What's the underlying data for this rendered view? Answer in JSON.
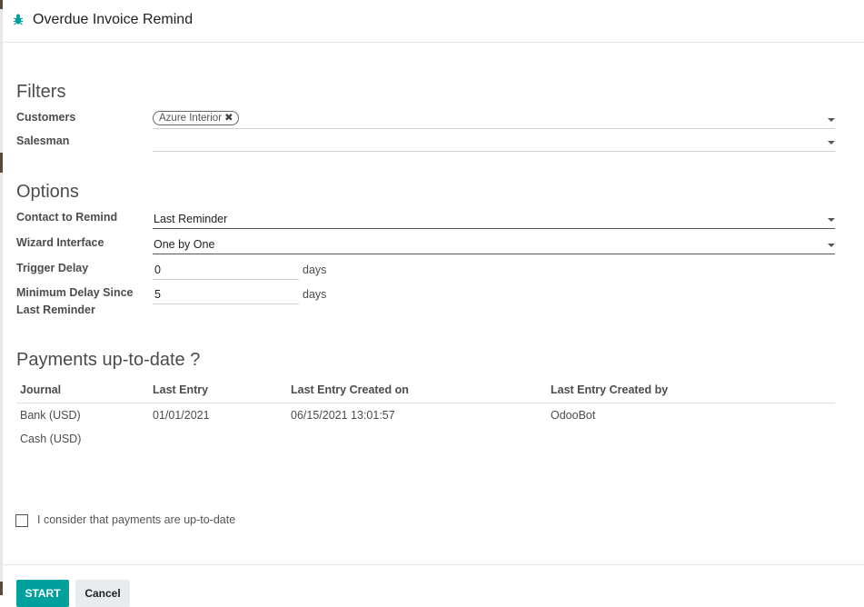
{
  "dialog": {
    "title": "Overdue Invoice Remind",
    "icon": "bug-icon"
  },
  "filters": {
    "section_title": "Filters",
    "customers_label": "Customers",
    "customers_tags": [
      "Azure Interior"
    ],
    "salesman_label": "Salesman",
    "salesman_value": ""
  },
  "options": {
    "section_title": "Options",
    "contact_label": "Contact to Remind",
    "contact_value": "Last Reminder",
    "wizard_label": "Wizard Interface",
    "wizard_value": "One by One",
    "trigger_label": "Trigger Delay",
    "trigger_value": "0",
    "trigger_unit": "days",
    "min_delay_label_line1": "Minimum Delay Since",
    "min_delay_label_line2": "Last Reminder",
    "min_delay_value": "5",
    "min_delay_unit": "days"
  },
  "payments": {
    "section_title": "Payments up-to-date ?",
    "columns": [
      "Journal",
      "Last Entry",
      "Last Entry Created on",
      "Last Entry Created by"
    ],
    "rows": [
      [
        "Bank (USD)",
        "01/01/2021",
        "06/15/2021 13:01:57",
        "OdooBot"
      ],
      [
        "Cash (USD)",
        "",
        "",
        ""
      ]
    ]
  },
  "confirm_checkbox": {
    "label": "I consider that payments are up-to-date",
    "checked": false
  },
  "buttons": {
    "start": "START",
    "cancel": "Cancel"
  },
  "colors": {
    "primary": "#00a09d",
    "text": "#4c4c4c"
  }
}
